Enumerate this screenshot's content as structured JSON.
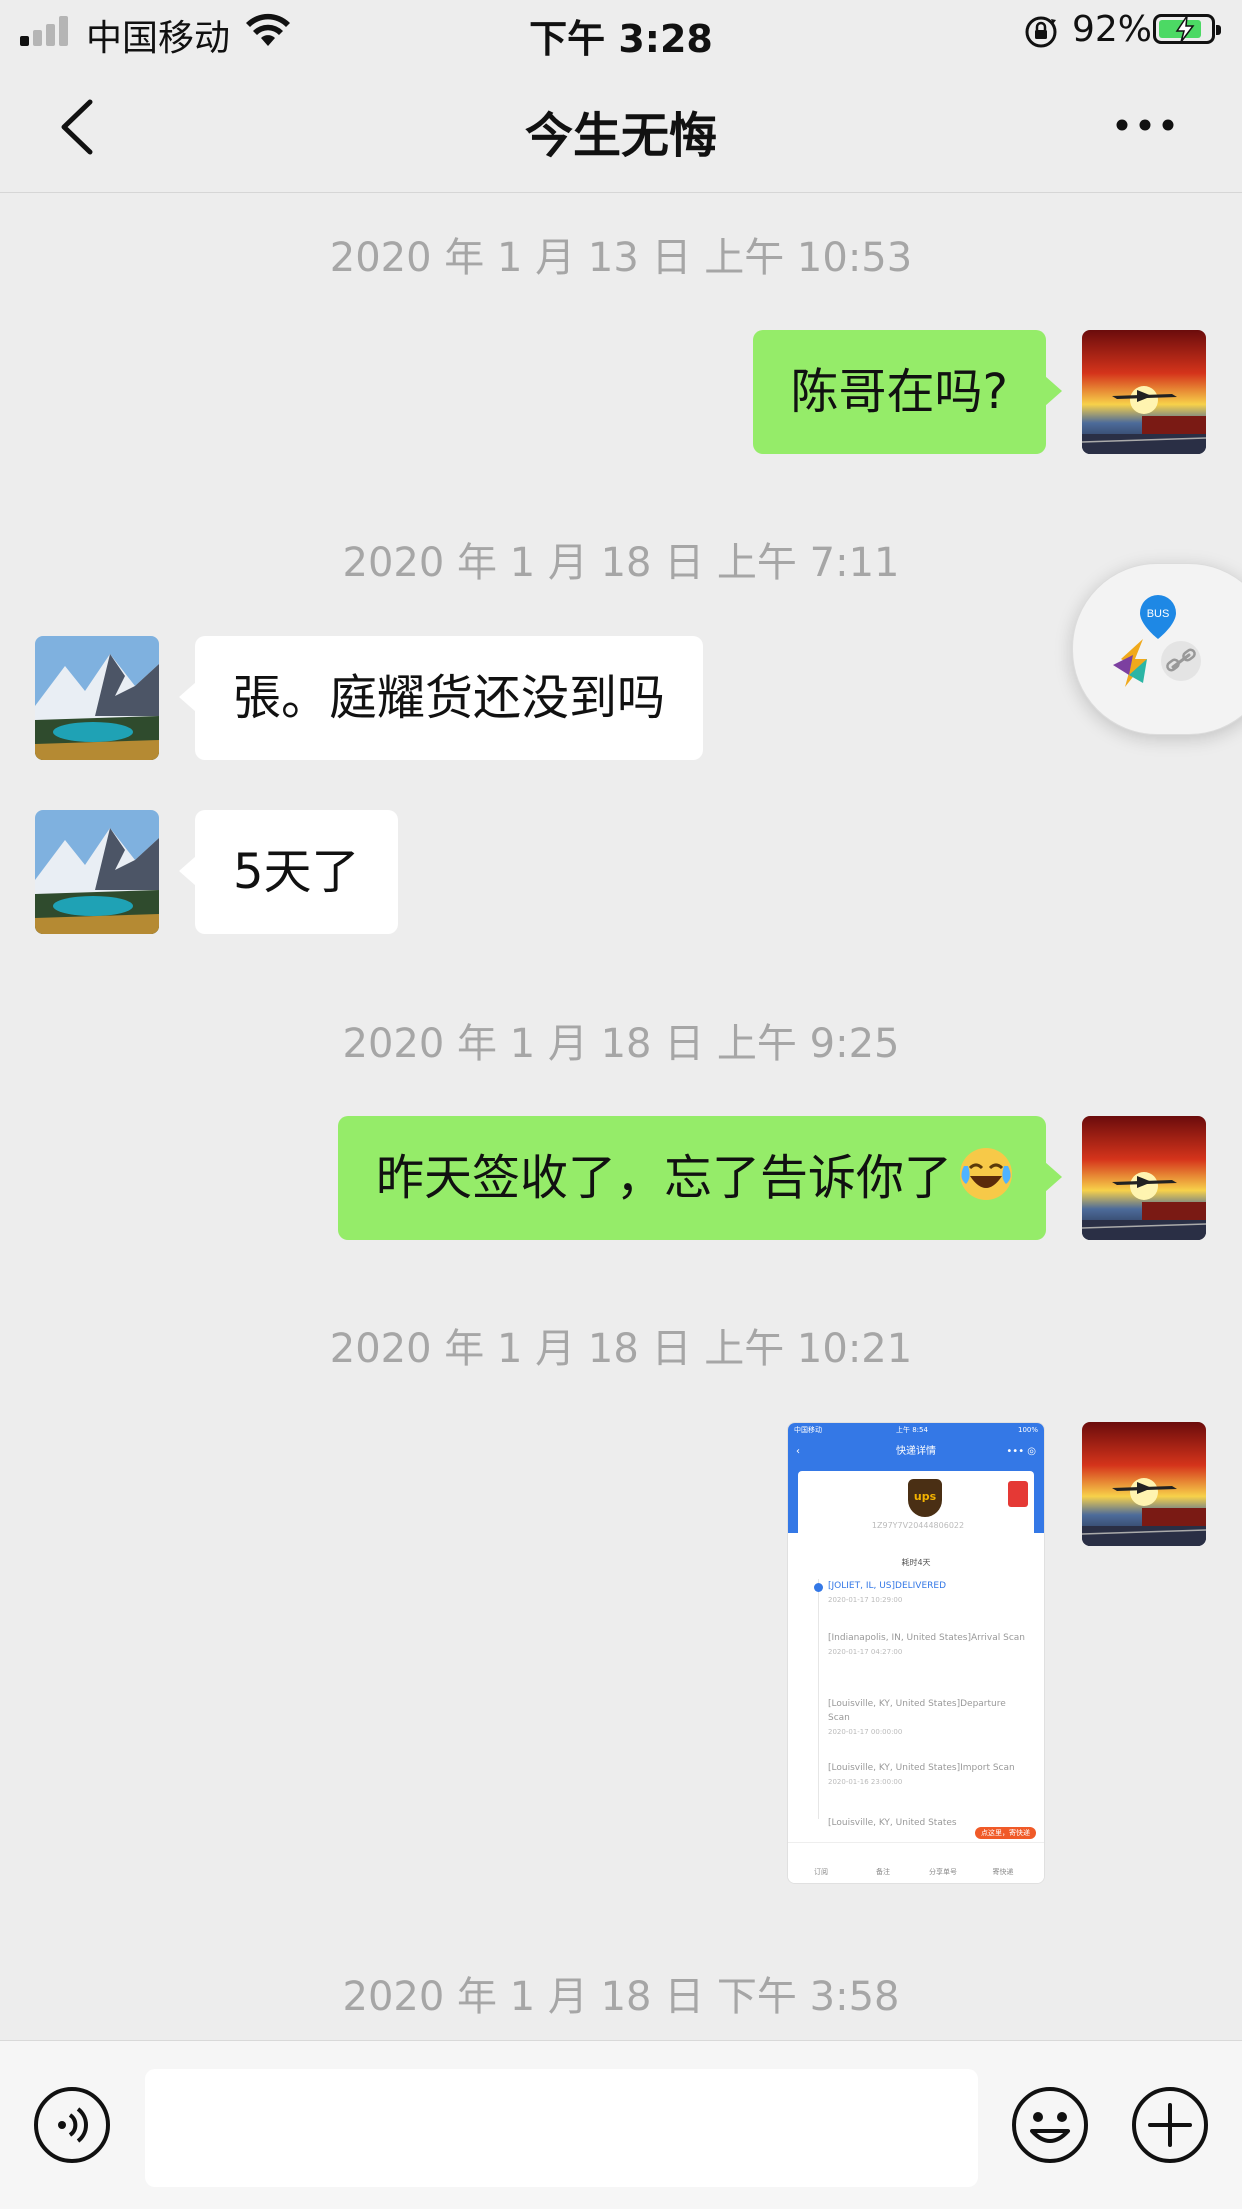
{
  "status_bar": {
    "carrier": "中国移动",
    "time": "下午 3:28",
    "battery_percent": "92%",
    "signal_bars_active": 1,
    "battery_level": 0.92
  },
  "nav": {
    "title": "今生无悔",
    "back_icon": "chevron-left-icon",
    "more_icon": "ellipsis-icon"
  },
  "messages": [
    {
      "type": "timestamp",
      "text": "2020 年 1 月 13 日 上午 10:53"
    },
    {
      "type": "text",
      "direction": "sent",
      "text": "陈哥在吗?"
    },
    {
      "type": "timestamp",
      "text": "2020 年 1 月 18 日 上午 7:11"
    },
    {
      "type": "text",
      "direction": "received",
      "text": "張。庭耀货还没到吗"
    },
    {
      "type": "text",
      "direction": "received",
      "text": "5天了"
    },
    {
      "type": "timestamp",
      "text": "2020 年 1 月 18 日 上午 9:25"
    },
    {
      "type": "text",
      "direction": "sent",
      "text": "昨天签收了，忘了告诉你了",
      "emoji": "laughing-crying-emoji"
    },
    {
      "type": "timestamp",
      "text": "2020 年 1 月 18 日 上午 10:21"
    },
    {
      "type": "image",
      "direction": "sent",
      "description_icon": "screenshot-thumbnail"
    },
    {
      "type": "timestamp",
      "text": "2020 年 1 月 18 日 下午 3:58"
    }
  ],
  "image_message": {
    "mini_status_left": "中国移动",
    "mini_status_time": "上午 8:54",
    "mini_status_right": "100%",
    "title": "快递详情",
    "carrier_logo": "ups",
    "tracking_number": "1Z97Y7V20444806022",
    "duration": "耗时4天",
    "entries": [
      {
        "text": "[JOLIET, IL, US]DELIVERED",
        "time": "2020-01-17 10:29:00"
      },
      {
        "text": "[Indianapolis, IN, United States]Arrival Scan",
        "time": "2020-01-17 04:27:00"
      },
      {
        "text": "[Louisville, KY, United States]Departure Scan",
        "time": "2020-01-17 00:00:00"
      },
      {
        "text": "[Louisville, KY, United States]Import Scan",
        "time": "2020-01-16 23:00:00"
      },
      {
        "text": "[Louisville, KY, United States",
        "time": ""
      }
    ],
    "tag": "点这里，寄快递",
    "tabs": [
      "订阅",
      "备注",
      "分享单号",
      "寄快递"
    ]
  },
  "floating_widget": {
    "icons": [
      "bus-location-icon",
      "colorful-logo-icon",
      "link-icon"
    ],
    "bus_label": "BUS"
  },
  "input_bar": {
    "placeholder": "",
    "value": "",
    "voice_icon": "voice-icon",
    "emoji_icon": "smiley-icon",
    "plus_icon": "plus-icon"
  },
  "colors": {
    "background": "#ededed",
    "sent_bubble": "#95ec69",
    "received_bubble": "#ffffff",
    "timestamp_text": "#a6a6a6",
    "battery_fill": "#4cd964"
  }
}
